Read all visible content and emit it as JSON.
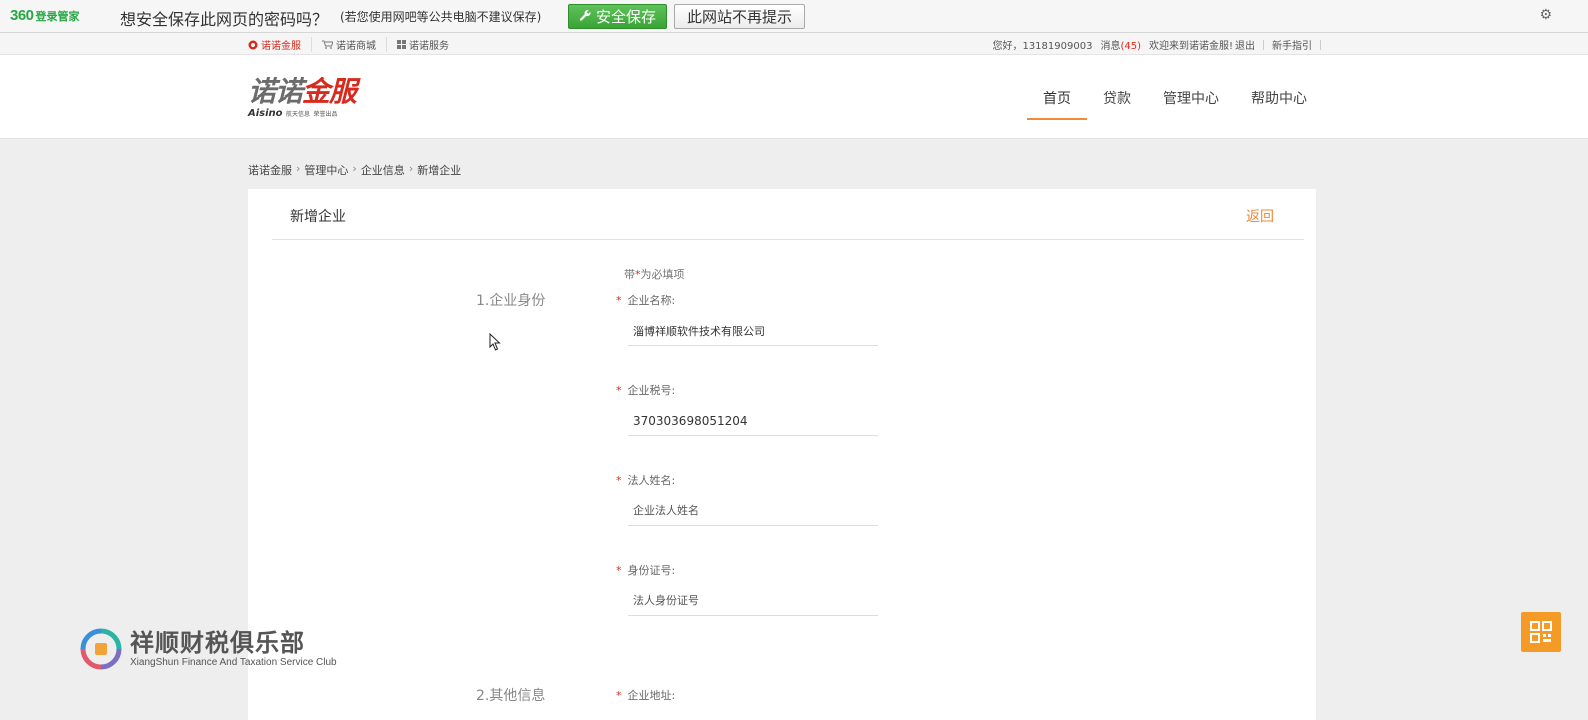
{
  "password_bar": {
    "brand": "360",
    "brand_sub": "登录管家",
    "question": "想安全保存此网页的密码吗？",
    "hint": "(若您使用网吧等公共电脑不建议保存)",
    "save_label": "安全保存",
    "never_label": "此网站不再提示",
    "settings_icon": "gear-icon"
  },
  "top_links": {
    "left": [
      "诺诺金服",
      "诺诺商城",
      "诺诺服务"
    ],
    "greeting": "您好，13181909003",
    "messages_label": "消息",
    "messages_count": "(45)",
    "welcome": "欢迎来到诺诺金服!",
    "logout": "退出",
    "guide": "新手指引"
  },
  "header": {
    "logo_cn_a": "诺诺",
    "logo_cn_b": "金服",
    "logo_en": "Aisino",
    "logo_en_sub1": "航天信息",
    "logo_en_sub2": "荣誉出品",
    "nav": [
      "首页",
      "贷款",
      "管理中心",
      "帮助中心"
    ],
    "active_nav": "首页",
    "accent_color": "#f08a3c",
    "brand_red": "#d62b1f"
  },
  "breadcrumb": [
    "诺诺金服",
    "管理中心",
    "企业信息",
    "新增企业"
  ],
  "card": {
    "title": "新增企业",
    "back": "返回",
    "required_note_prefix": "带",
    "required_note_star": "*",
    "required_note_suffix": "为必填项",
    "sections": [
      "1.企业身份",
      "2.其他信息"
    ],
    "fields": [
      {
        "label": "企业名称:",
        "value": "淄博祥顺软件技术有限公司",
        "placeholder": ""
      },
      {
        "label": "企业税号:",
        "value": "370303698051204",
        "placeholder": ""
      },
      {
        "label": "法人姓名:",
        "value": "",
        "placeholder": "企业法人姓名"
      },
      {
        "label": "身份证号:",
        "value": "",
        "placeholder": "法人身份证号"
      },
      {
        "label": "企业地址:",
        "value": "",
        "placeholder": ""
      }
    ]
  },
  "watermark": {
    "title": "祥顺财税俱乐部",
    "subtitle": "XiangShun Finance And Taxation Service Club"
  }
}
